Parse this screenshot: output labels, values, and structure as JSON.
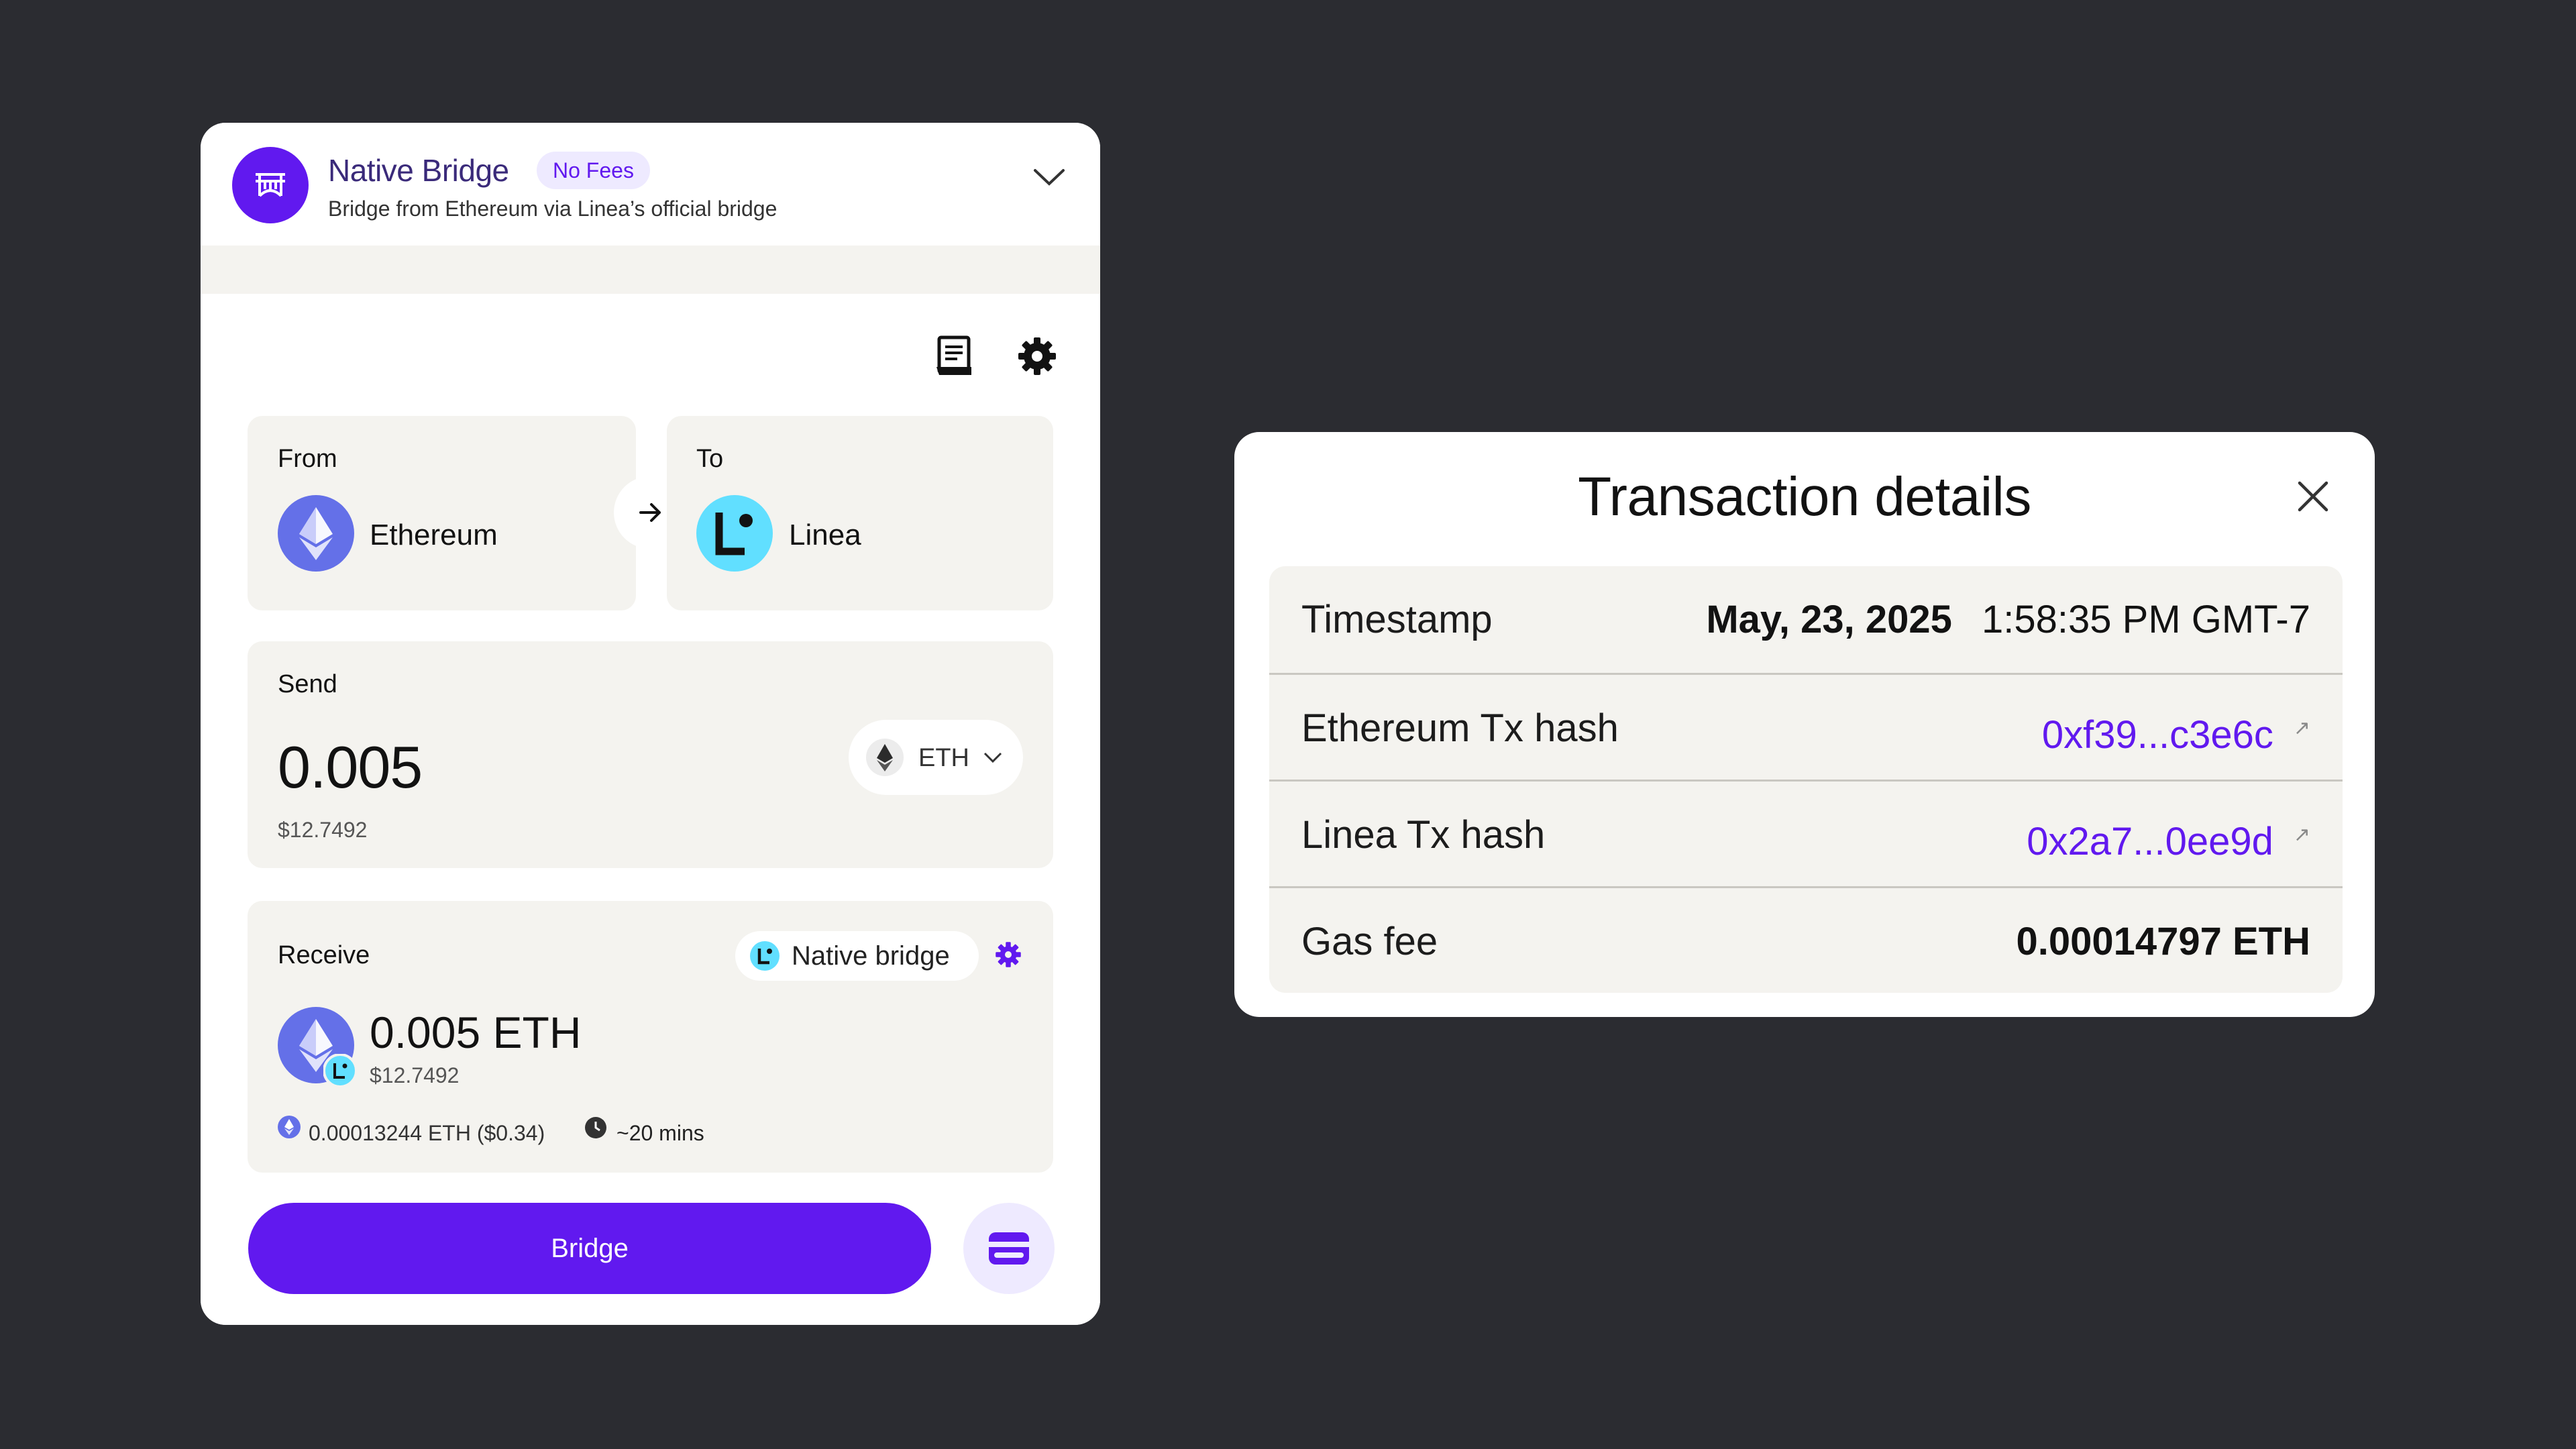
{
  "bridge": {
    "title": "Native Bridge",
    "badge": "No Fees",
    "subtitle": "Bridge from Ethereum via Linea’s official bridge",
    "from_label": "From",
    "from_chain": "Ethereum",
    "to_label": "To",
    "to_chain": "Linea",
    "send_label": "Send",
    "send_amount": "0.005",
    "send_usd": "$12.7492",
    "token": "ETH",
    "receive_label": "Receive",
    "route": "Native bridge",
    "receive_amount": "0.005 ETH",
    "receive_usd": "$12.7492",
    "fee": "0.00013244 ETH ($0.34)",
    "time": "~20 mins",
    "button": "Bridge"
  },
  "tx_details": {
    "title": "Transaction details",
    "rows": [
      {
        "label": "Timestamp",
        "date": "May, 23, 2025",
        "time": "1:58:35 PM GMT-7"
      },
      {
        "label": "Ethereum Tx hash",
        "value": "0xf39...c3e6c"
      },
      {
        "label": "Linea Tx hash",
        "value": "0x2a7...0ee9d"
      },
      {
        "label": "Gas fee",
        "value": "0.00014797 ETH"
      }
    ]
  },
  "colors": {
    "background": "#2b2c31",
    "accent": "#6119ef",
    "card": "#f4f3ef",
    "linea": "#61dfff",
    "ethereum": "#6470e8"
  },
  "icons": [
    "bridge-logo-icon",
    "chevron-down-icon",
    "receipt-icon",
    "gear-icon",
    "ethereum-icon",
    "linea-icon",
    "arrow-right-icon",
    "clock-icon",
    "wallet-icon",
    "close-icon",
    "external-link-icon"
  ]
}
